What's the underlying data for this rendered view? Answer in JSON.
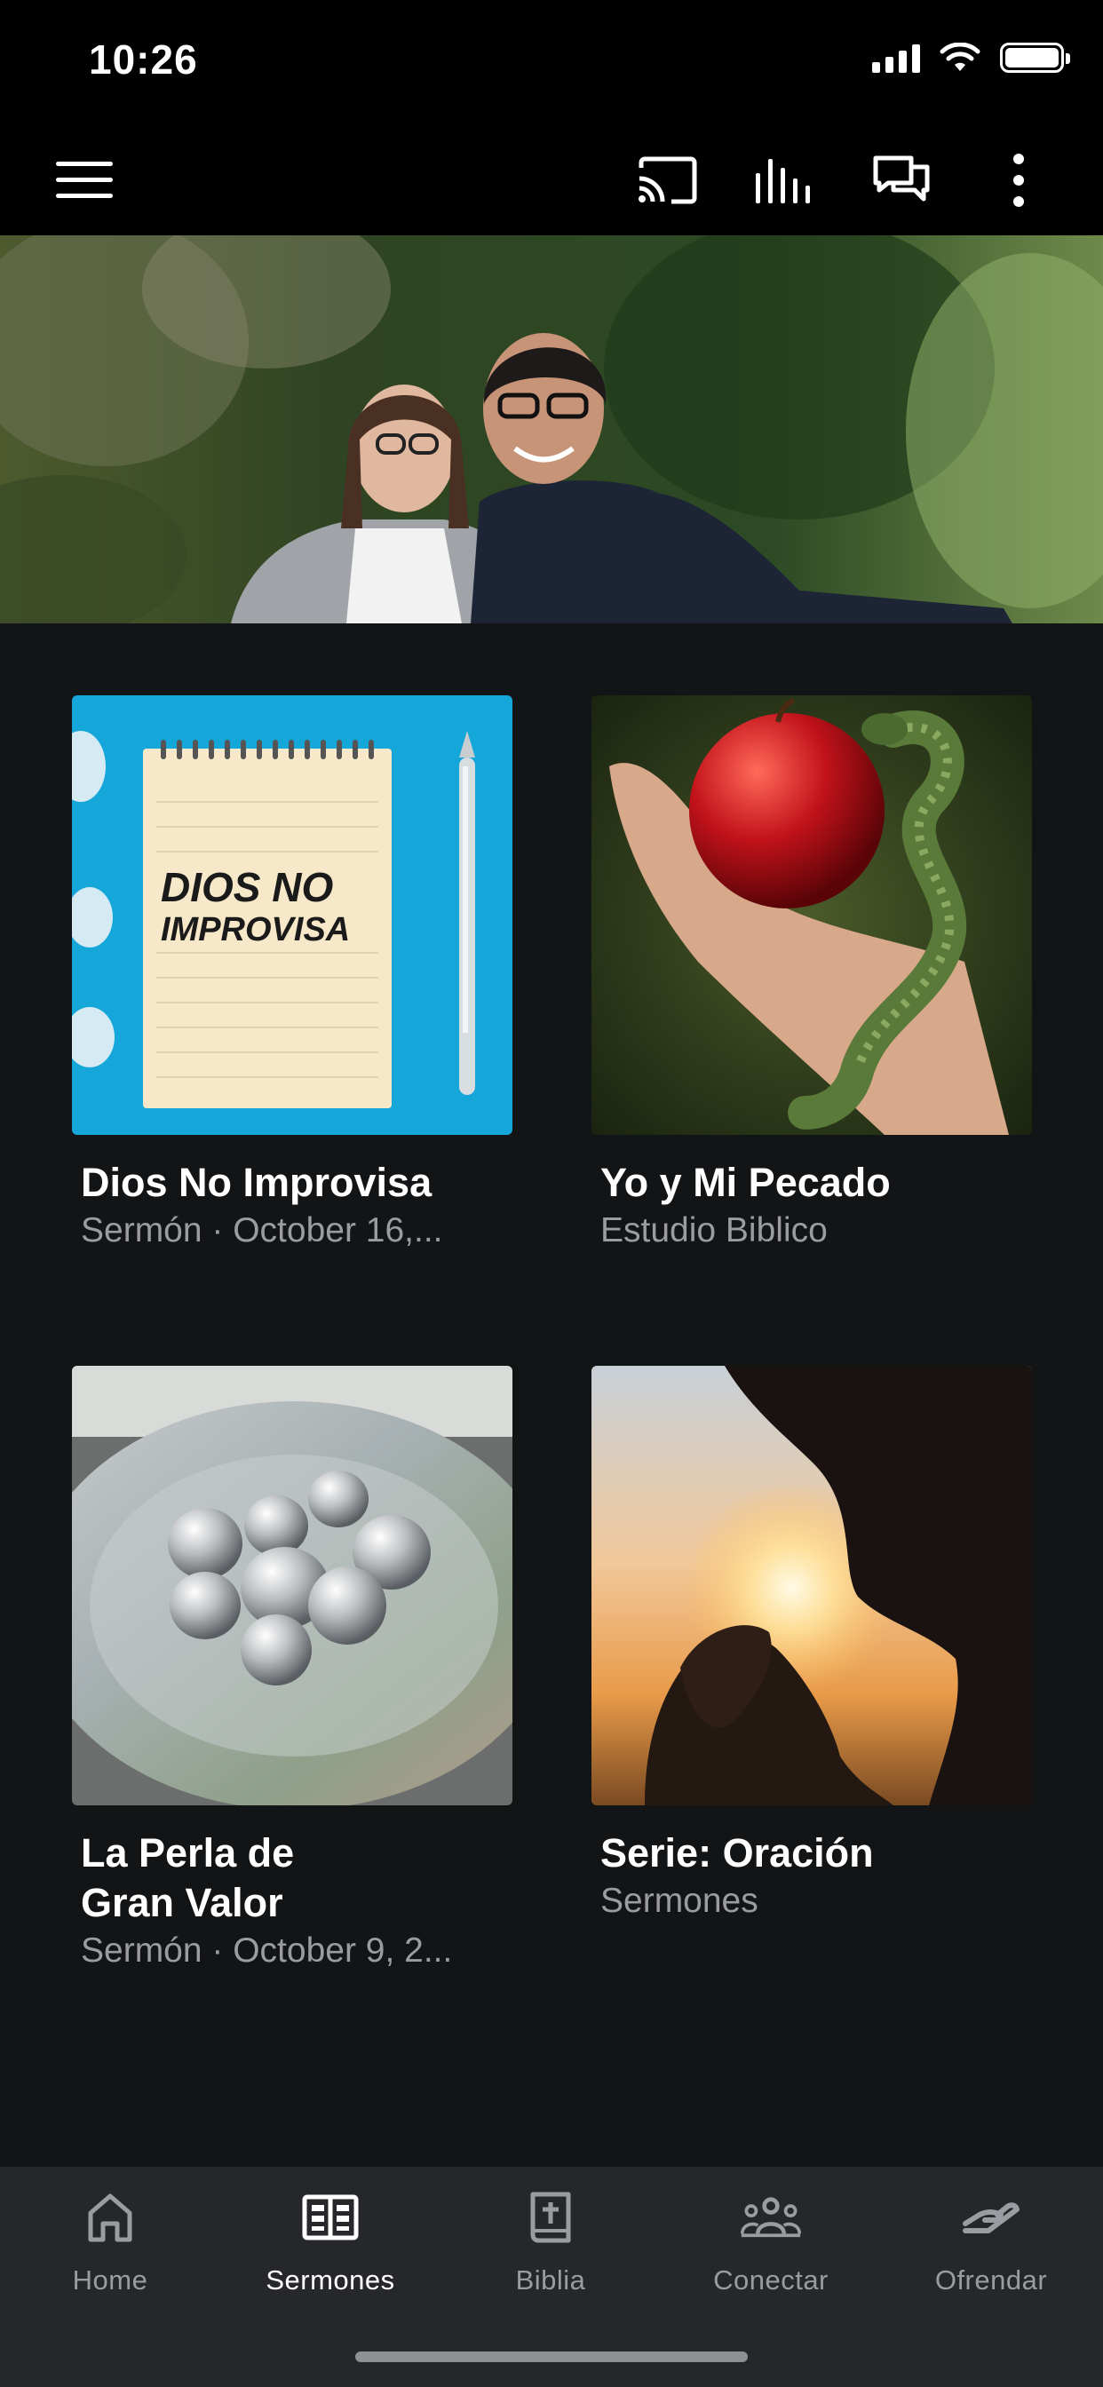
{
  "status_bar": {
    "time": "10:26"
  },
  "cards": [
    {
      "thumb_text_1": "DIOS NO",
      "thumb_text_2": "IMPROVISA",
      "title": "Dios No Improvisa",
      "subtitle": "Sermón · October 16,..."
    },
    {
      "title": "Yo y Mi Pecado",
      "subtitle": "Estudio Biblico"
    },
    {
      "title": "La Perla de\nGran Valor",
      "subtitle": "Sermón · October 9, 2..."
    },
    {
      "title": "Serie: Oración",
      "subtitle": "Sermones"
    }
  ],
  "tabs": [
    {
      "label": "Home",
      "icon": "home-icon",
      "active": false
    },
    {
      "label": "Sermones",
      "icon": "book-icon",
      "active": true
    },
    {
      "label": "Biblia",
      "icon": "bible-icon",
      "active": false
    },
    {
      "label": "Conectar",
      "icon": "group-icon",
      "active": false
    },
    {
      "label": "Ofrendar",
      "icon": "give-icon",
      "active": false
    }
  ],
  "colors": {
    "background": "#131416",
    "tabbar": "#25272b",
    "inactive": "#9a9ca1",
    "active": "#ffffff"
  }
}
